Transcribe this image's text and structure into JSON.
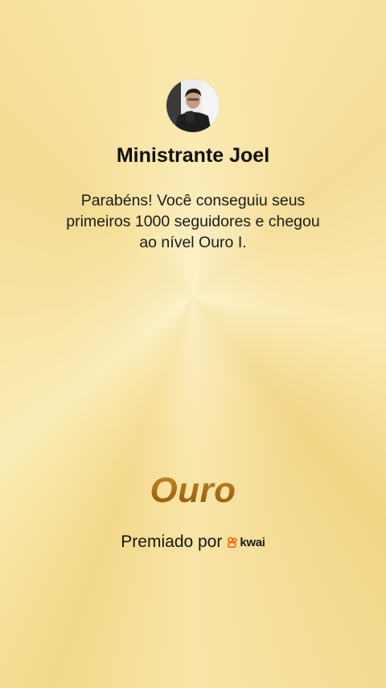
{
  "profile": {
    "avatar": "user-avatar-photo",
    "name": "Ministrante Joel"
  },
  "message": {
    "line1": "Parabéns! Você conseguiu seus",
    "line2": "primeiros 1000 seguidores e chegou",
    "line3": "ao nível Ouro I."
  },
  "tier": {
    "label": "Ouro",
    "color": "#a8690f"
  },
  "awarded": {
    "label": "Premiado por",
    "brand": "kwai",
    "brand_icon": "kwai-logo-icon",
    "brand_color": "#ff6a1a"
  },
  "theme": {
    "background": "#f6e3a3"
  }
}
